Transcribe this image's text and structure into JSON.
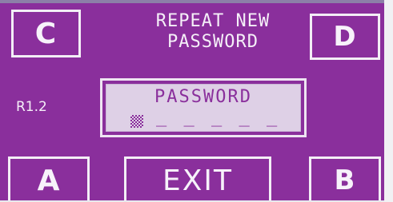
{
  "buttons": {
    "c_label": "C",
    "d_label": "D",
    "a_label": "A",
    "b_label": "B",
    "exit_label": "EXIT"
  },
  "title": {
    "line1": "REPEAT NEW",
    "line2": "PASSWORD"
  },
  "version": "R1.2",
  "password_field": {
    "label": "PASSWORD",
    "placeholder": "_ _ _ _ _"
  },
  "colors": {
    "screen_bg": "#8a2f9c",
    "foreground": "#f5eff8",
    "field_bg": "#ded0e6"
  }
}
